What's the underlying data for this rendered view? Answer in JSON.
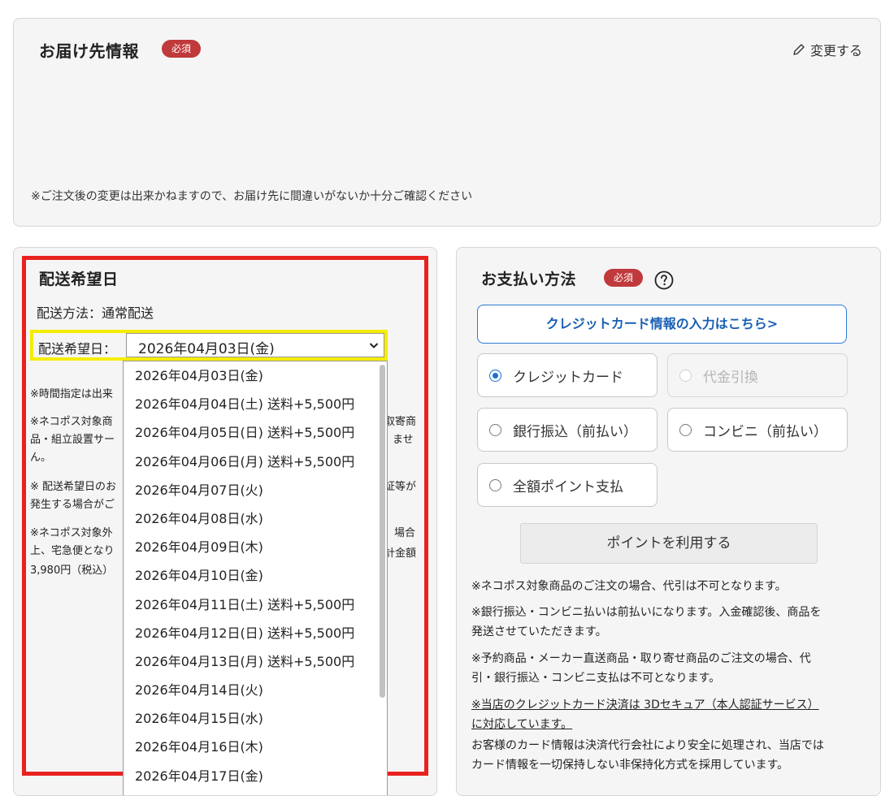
{
  "shipping_info": {
    "title": "お届け先情報",
    "required_badge": "必須",
    "change_label": "変更する",
    "note": "※ご注文後の変更は出来かねますので、お届け先に間違いがないか十分ご確認ください"
  },
  "delivery": {
    "title": "配送希望日",
    "method": "配送方法：通常配送",
    "date_label": "配送希望日：",
    "selected_date": "2026年04月03日(金)",
    "options": [
      "2026年04月03日(金)",
      "2026年04月04日(土) 送料+5,500円",
      "2026年04月05日(日) 送料+5,500円",
      "2026年04月06日(月) 送料+5,500円",
      "2026年04月07日(火)",
      "2026年04月08日(水)",
      "2026年04月09日(木)",
      "2026年04月10日(金)",
      "2026年04月11日(土) 送料+5,500円",
      "2026年04月12日(日) 送料+5,500円",
      "2026年04月13日(月) 送料+5,500円",
      "2026年04月14日(火)",
      "2026年04月15日(水)",
      "2026年04月16日(木)",
      "2026年04月17日(金)"
    ],
    "notes_left": [
      "※時間指定は出来",
      "※ネコポス対象商",
      "品・組立設置サー",
      "ん。",
      "※ 配送希望日のお",
      "発生する場合がご",
      "※ネコポス対象外",
      "上、宅急便となり",
      "3,980円（税込）"
    ],
    "notes_right": [
      "取寄商",
      "ませ",
      "証等が",
      "場合",
      "計金額"
    ]
  },
  "payment": {
    "title": "お支払い方法",
    "required_badge": "必須",
    "card_input_button": "クレジットカード情報の入力はこちら>",
    "options": {
      "credit_card": "クレジットカード",
      "cod": "代金引換",
      "bank": "銀行振込（前払い）",
      "convenience": "コンビニ（前払い）",
      "points_all": "全額ポイント支払"
    },
    "selected": "credit_card",
    "use_points_button": "ポイントを利用する",
    "notes": [
      "※ネコポス対象商品のご注文の場合、代引は不可となります。",
      "※銀行振込・コンビニ払いは前払いになります。入金確認後、商品を",
      "発送させていただきます。",
      "※予約商品・メーカー直送商品・取り寄せ商品のご注文の場合、代",
      "引・銀行振込・コンビニ支払は不可となります。",
      "※当店のクレジットカード決済は 3Dセキュア（本人認証サービス）",
      "に対応しています。",
      "お客様のカード情報は決済代行会社により安全に処理され、当店では",
      "カード情報を一切保持しない非保持化方式を採用しています。"
    ]
  },
  "colors": {
    "required_badge": "#c0393b",
    "highlight_red": "#e8221f",
    "highlight_yellow": "#f5ec00",
    "link_blue": "#1a5fb4"
  },
  "icons": {
    "change": "pencil-icon",
    "help": "question-circle-icon",
    "select": "chevron-down-icon"
  }
}
